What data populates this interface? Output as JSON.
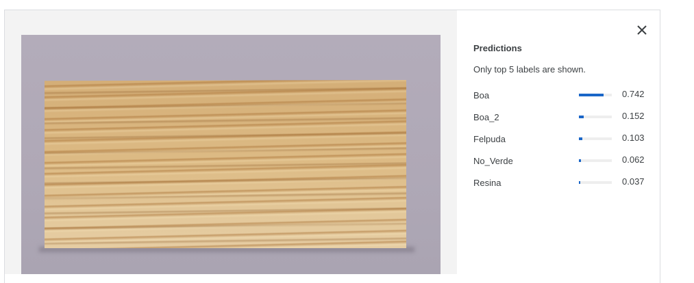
{
  "panel": {
    "title": "Predictions",
    "note": "Only top 5 labels are shown."
  },
  "close_icon": "close-icon",
  "accent_color": "#1a66c8",
  "predictions": [
    {
      "label": "Boa",
      "value": "0.742",
      "score": 0.742
    },
    {
      "label": "Boa_2",
      "value": "0.152",
      "score": 0.152
    },
    {
      "label": "Felpuda",
      "value": "0.103",
      "score": 0.103
    },
    {
      "label": "No_Verde",
      "value": "0.062",
      "score": 0.062
    },
    {
      "label": "Resina",
      "value": "0.037",
      "score": 0.037
    }
  ]
}
